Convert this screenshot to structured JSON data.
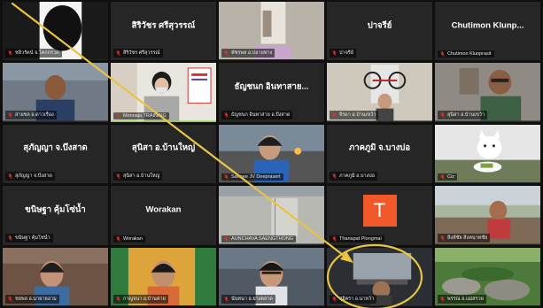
{
  "meeting": {
    "participants": [
      {
        "id": "p1",
        "label": "ชลิวรัตน์ จ.โคกกรวด",
        "center": "",
        "scene": "face-dark",
        "speaking": false
      },
      {
        "id": "p2",
        "label": "สิริวัชร ศรีสุวรรณ์",
        "center": "สิริวัชร ศรีสุวรรณ์",
        "scene": "none",
        "speaking": false
      },
      {
        "id": "p3",
        "label": "พัชรพล อ.ปลายทาง",
        "center": "",
        "scene": "indoor-window",
        "speaking": false
      },
      {
        "id": "p4",
        "label": "ปาจรีย์",
        "center": "ปาจรีย์",
        "scene": "none",
        "speaking": false
      },
      {
        "id": "p5",
        "label": "Chutimon Klunprasit",
        "center": "Chutimon Klunp...",
        "scene": "none",
        "speaking": false
      },
      {
        "id": "p6",
        "label": "สายชล อ.ดาวเรือง",
        "center": "",
        "scene": "man-indoor",
        "speaking": false
      },
      {
        "id": "p7",
        "label": "Monnaja TRAINING",
        "center": "",
        "scene": "presenter",
        "speaking": true
      },
      {
        "id": "p8",
        "label": "ธัญชนก อินทาสาย อ.บึงสาด",
        "center": "ธัญชนก อินทาสาย...",
        "scene": "none",
        "speaking": false
      },
      {
        "id": "p9",
        "label": "จีรดา อ.บ้านเขว้า",
        "center": "",
        "scene": "bike-room",
        "speaking": false
      },
      {
        "id": "p10",
        "label": "สุนิสา อ.บ้านเขว้า",
        "center": "",
        "scene": "man-glasses",
        "speaking": false
      },
      {
        "id": "p11",
        "label": "สุภัญญา จ.บึงสาด",
        "center": "สุภัญญา จ.บึงสาด",
        "scene": "none",
        "speaking": false
      },
      {
        "id": "p12",
        "label": "สุนิสา อ.บ้านใหญ่",
        "center": "สุนิสา อ.บ้านใหญ่",
        "scene": "none",
        "speaking": false
      },
      {
        "id": "p13",
        "label": "Sarinee JV Deeprasert",
        "center": "",
        "scene": "woman-car",
        "speaking": false
      },
      {
        "id": "p14",
        "label": "ภาคภูมิ อ.บางบ่อ",
        "center": "ภาคภูมิ จ.บางบ่อ",
        "scene": "none",
        "speaking": false
      },
      {
        "id": "p15",
        "label": "Ciz",
        "center": "",
        "scene": "cat-meme",
        "speaking": false
      },
      {
        "id": "p16",
        "label": "ขนิษฐา คุ้มโซ่น้ำ",
        "center": "ขนิษฐา คุ้มโซ่น้ำ",
        "scene": "none",
        "speaking": false
      },
      {
        "id": "p17",
        "label": "Worakan",
        "center": "Worakan",
        "scene": "none",
        "speaking": false
      },
      {
        "id": "p18",
        "label": "AUNCHAVA SAENGTHONG",
        "center": "",
        "scene": "ceiling",
        "speaking": false
      },
      {
        "id": "p19",
        "label": "Thanapat Plongmai",
        "center": "",
        "scene": "avatar-T",
        "avatar": "T",
        "speaking": false
      },
      {
        "id": "p20",
        "label": "สิงห์ชัย สิงหนาทชัย",
        "center": "",
        "scene": "outdoor-man",
        "speaking": false
      },
      {
        "id": "p21",
        "label": "ชยพล อ.นายายอาม",
        "center": "",
        "scene": "woman-room",
        "speaking": false
      },
      {
        "id": "p22",
        "label": "กาญจนา อ.บ้านค่าย",
        "center": "",
        "scene": "woman-curtain",
        "speaking": false
      },
      {
        "id": "p23",
        "label": "นันทนา อ.ยางตลาด",
        "center": "",
        "scene": "woman-glasses",
        "speaking": false
      },
      {
        "id": "p24",
        "label": "สุจิตรา อ.นาหว้า",
        "center": "",
        "scene": "car-view",
        "speaking": false
      },
      {
        "id": "p25",
        "label": "พรรณ อ.แม่สรวย",
        "center": "",
        "scene": "nature",
        "speaking": false
      }
    ]
  },
  "colors": {
    "tile_bg": "#262626",
    "mic_muted": "#e0322d",
    "speaking_border": "#8fcf3c",
    "annotation": "#e8c443"
  },
  "annotation": {
    "shape": "arrow-to-circle",
    "target": "p24"
  }
}
